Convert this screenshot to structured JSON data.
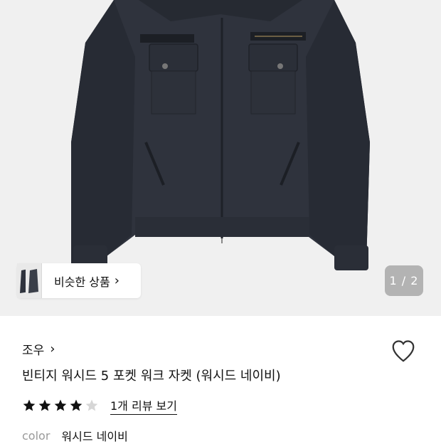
{
  "gallery": {
    "similar_label": "비슷한 상품",
    "counter": "1 / 2"
  },
  "product": {
    "brand": "조우",
    "title": "빈티지 워시드 5 포켓 워크 자켓 (워시드 네이비)",
    "rating": 4,
    "rating_max": 5,
    "reviews_link": "1개 리뷰 보기",
    "color_label": "color",
    "color_value": "워시드 네이비"
  },
  "icons": {
    "brand_chevron": "chevron-right-icon",
    "wishlist": "heart-outline-icon",
    "star_filled": "star-filled-icon",
    "star_empty": "star-empty-icon"
  },
  "colors": {
    "jacket": "#2f333d",
    "star_filled": "#111111",
    "star_empty": "#d6d6d6",
    "counter_bg": "#b3b3b3",
    "hero_bg": "#f0f0f0"
  }
}
